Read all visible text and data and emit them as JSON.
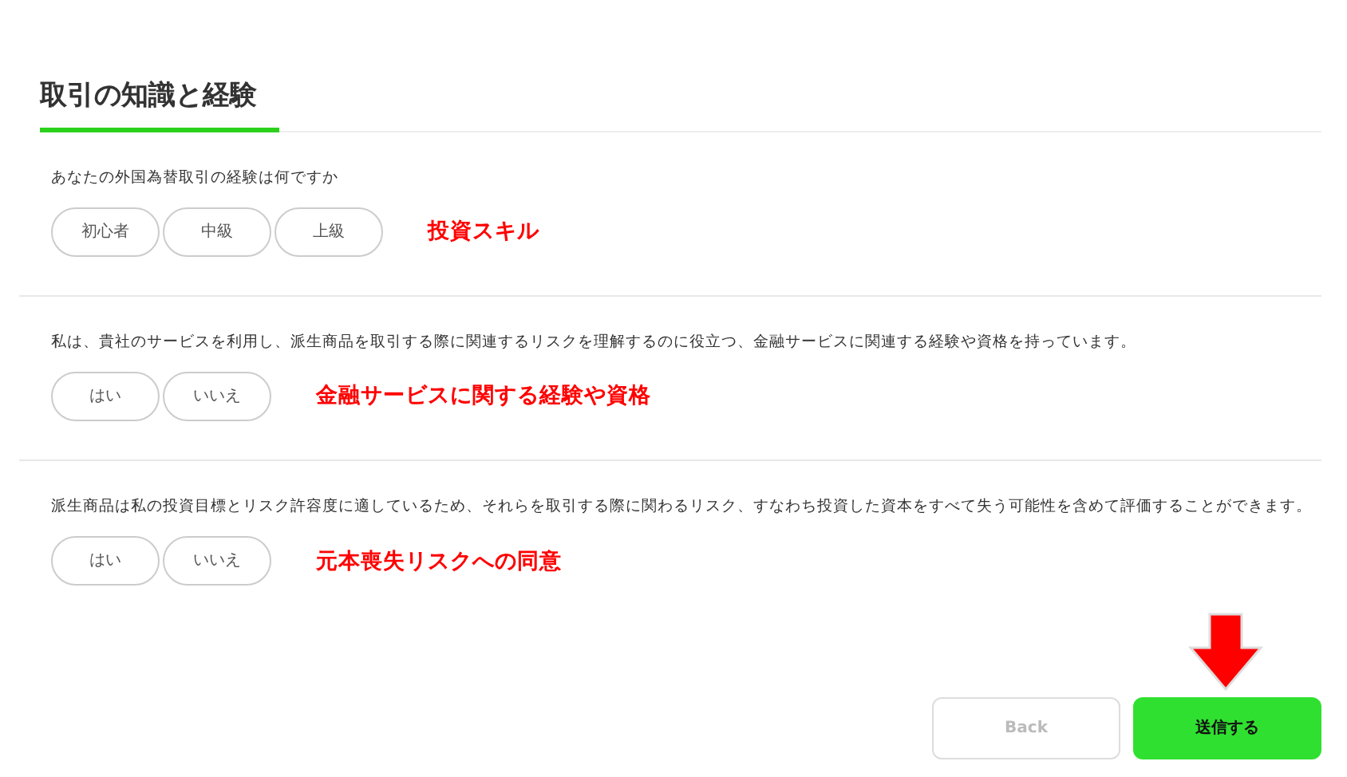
{
  "section": {
    "title": "取引の知識と経験"
  },
  "questions": [
    {
      "text": "あなたの外国為替取引の経験は何ですか",
      "options": [
        "初心者",
        "中級",
        "上級"
      ],
      "annotation": "投資スキル"
    },
    {
      "text": "私は、貴社のサービスを利用し、派生商品を取引する際に関連するリスクを理解するのに役立つ、金融サービスに関連する経験や資格を持っています。",
      "options": [
        "はい",
        "いいえ"
      ],
      "annotation": "金融サービスに関する経験や資格"
    },
    {
      "text": "派生商品は私の投資目標とリスク許容度に適しているため、それらを取引する際に関わるリスク、すなわち投資した資本をすべて失う可能性を含めて評価することができます。",
      "options": [
        "はい",
        "いいえ"
      ],
      "annotation": "元本喪失リスクへの同意"
    }
  ],
  "buttons": [
    {
      "label": "Back",
      "kind": "secondary",
      "disabled": true
    },
    {
      "label": "送信する",
      "kind": "primary",
      "disabled": false
    }
  ]
}
